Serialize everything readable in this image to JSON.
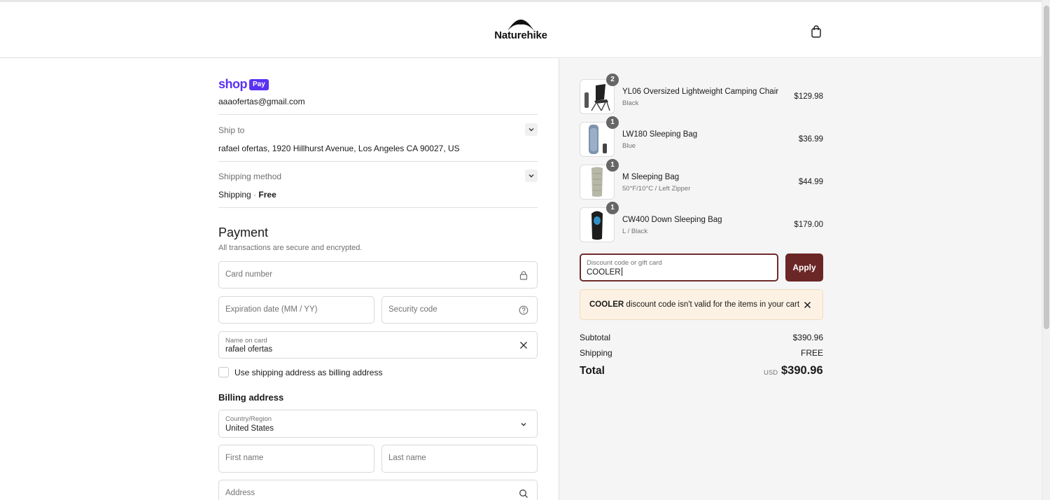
{
  "header": {
    "brand": "Naturehike",
    "cart_icon": "shopping-bag-icon"
  },
  "contact": {
    "shop_label": "shop",
    "pay_label": "Pay",
    "email": "aaaofertas@gmail.com"
  },
  "ship_to": {
    "label": "Ship to",
    "value": "rafael ofertas, 1920 Hillhurst Avenue, Los Angeles CA 90027, US"
  },
  "shipping_method": {
    "label": "Shipping method",
    "value_name": "Shipping",
    "separator": "·",
    "value_price": "Free"
  },
  "payment": {
    "title": "Payment",
    "subtitle": "All transactions are secure and encrypted.",
    "card_number_placeholder": "Card number",
    "expiration_placeholder": "Expiration date (MM / YY)",
    "security_placeholder": "Security code",
    "name_label": "Name on card",
    "name_value": "rafael ofertas",
    "billing_checkbox_label": "Use shipping address as billing address"
  },
  "billing": {
    "title": "Billing address",
    "country_label": "Country/Region",
    "country_value": "United States",
    "first_name_placeholder": "First name",
    "last_name_placeholder": "Last name",
    "address_placeholder": "Address"
  },
  "cart": {
    "items": [
      {
        "name": "YL06 Oversized Lightweight Camping Chair",
        "variant": "Black",
        "qty": "2",
        "price": "$129.98"
      },
      {
        "name": "LW180 Sleeping Bag",
        "variant": "Blue",
        "qty": "1",
        "price": "$36.99"
      },
      {
        "name": "M Sleeping Bag",
        "variant": "50°F/10°C / Left Zipper",
        "qty": "1",
        "price": "$44.99"
      },
      {
        "name": "CW400 Down Sleeping Bag",
        "variant": "L / Black",
        "qty": "1",
        "price": "$179.00"
      }
    ]
  },
  "discount": {
    "label": "Discount code or gift card",
    "value": "COOLER",
    "apply_label": "Apply",
    "error_code": "COOLER",
    "error_text": " discount code isn't valid for the items in your cart"
  },
  "summary": {
    "subtotal_label": "Subtotal",
    "subtotal_value": "$390.96",
    "shipping_label": "Shipping",
    "shipping_value": "FREE",
    "total_label": "Total",
    "currency": "USD",
    "total_value": "$390.96"
  },
  "colors": {
    "shop_pay": "#5a31f4",
    "apply_button": "#6b2626",
    "alert_bg": "#fdf1e3",
    "right_pane_bg": "#f5f5f5"
  }
}
